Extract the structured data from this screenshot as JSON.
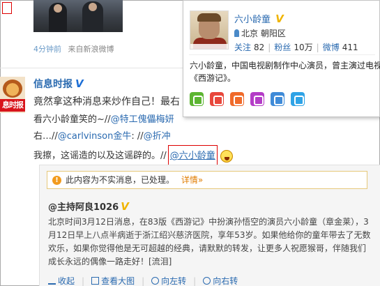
{
  "feed_top": {
    "time": "4分钟前",
    "source": "来自新浪微博"
  },
  "post": {
    "avatar_label": "息时报",
    "author": "信息时报",
    "verified_mark": "V",
    "line1": "竟然拿这种消息来炒作自己！最右",
    "line2_prefix": "看六小龄童笑的~//",
    "line2_mention": "@特工傀儡梅妍",
    "line3_prefix": "右…//",
    "line3_mention1": "@carlvinson金牛",
    "line3_mid": ": //",
    "line3_mention2": "@折冲",
    "line4_prefix": "我擦，这谣造的以及这谣辟的。//",
    "line4_mention": "@六小龄童"
  },
  "quote": {
    "notice_icon": "!",
    "notice": "此内容为不实消息，已处理。",
    "notice_detail": "详情»",
    "author": "@主持阿良1026",
    "verified_mark": "V",
    "body": "北京时间3月12日消息，在83版《西游记》中扮演孙悟空的演员六小龄童（章金莱），3月12日早上八点半病逝于浙江绍兴慈济医院，享年53岁。如果他给你的童年带去了无数欢乐，如果你觉得他是无可超越的经典，请默默的转发，让更多人祝愿猴哥，伴随我们成长永远的偶像一路走好！[流泪]",
    "actions": [
      "收起",
      "查看大图",
      "向左转",
      "向右转"
    ]
  },
  "card": {
    "name": "六小龄童",
    "verified_mark": "V",
    "location": "北京  朝阳区",
    "stats": [
      {
        "label": "关注",
        "value": "82"
      },
      {
        "label": "粉丝",
        "value": "10万"
      },
      {
        "label": "微博",
        "value": "411"
      }
    ],
    "description": "六小龄童，中国电视剧制作中心演员，曾主演过电视剧《西游记》。",
    "icons": [
      {
        "name": "follow-icon",
        "color": "#5cb531"
      },
      {
        "name": "gift-icon",
        "color": "#e8473b"
      },
      {
        "name": "down-icon",
        "color": "#f06a2a"
      },
      {
        "name": "tv-icon",
        "color": "#b43cc7"
      },
      {
        "name": "hand-icon",
        "color": "#3f8bd8"
      },
      {
        "name": "chat-icon",
        "color": "#2fa3e6"
      }
    ]
  }
}
